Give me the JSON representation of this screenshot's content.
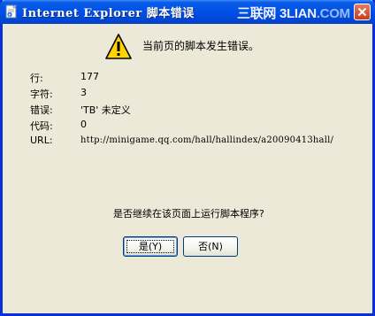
{
  "window": {
    "title": "Internet Explorer 脚本错误",
    "watermark_part1": "三联网 3LIAN",
    "watermark_part2": ".COM"
  },
  "message": "当前页的脚本发生错误。",
  "details": [
    {
      "label": "行:",
      "value": "177"
    },
    {
      "label": "字符:",
      "value": "3"
    },
    {
      "label": "错误:",
      "value": "'TB' 未定义"
    },
    {
      "label": "代码:",
      "value": "0"
    },
    {
      "label": "URL:",
      "value": "http://minigame.qq.com/hall/hallindex/a20090413hall/"
    }
  ],
  "question": "是否继续在该页面上运行脚本程序?",
  "buttons": {
    "yes": "是(Y)",
    "no": "否(N)"
  },
  "icons": {
    "title": "ie-page-icon",
    "warning": "warning-icon",
    "close": "close-icon"
  },
  "colors": {
    "titlebar": "#0050e8",
    "window_bg": "#ece9d8",
    "warning": "#ffd400"
  }
}
